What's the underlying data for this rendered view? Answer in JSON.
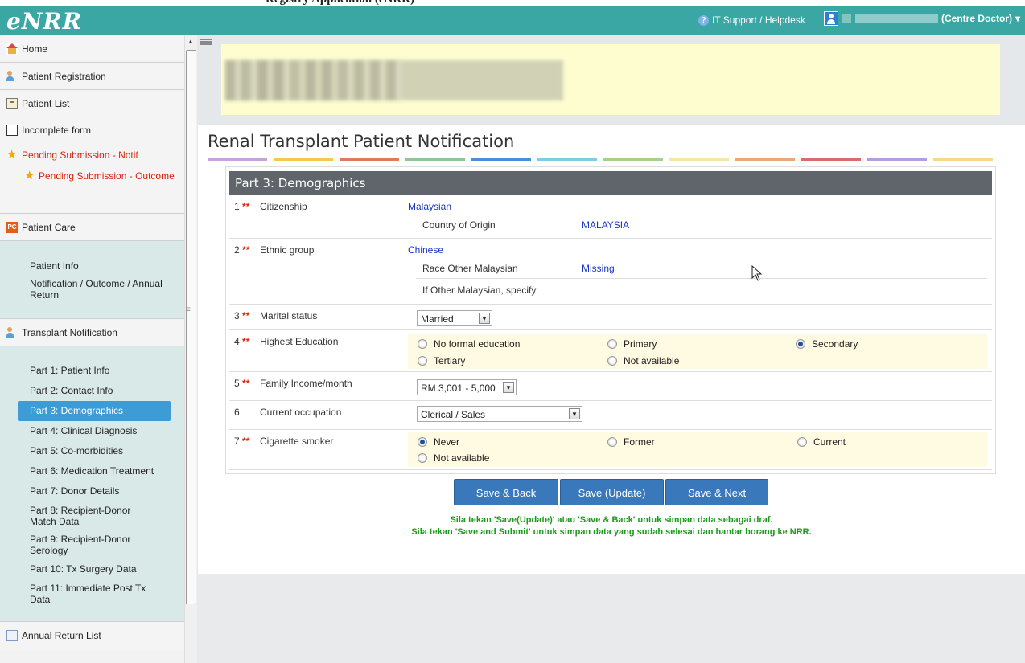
{
  "app": {
    "logo": "eNRR",
    "top_cut_text": "Registry Application (eNRR)",
    "helpdesk": "IT Support / Helpdesk",
    "user_role": "(Centre Doctor)"
  },
  "sidebar": {
    "items": [
      {
        "label": "Home",
        "icon": "home-icon"
      },
      {
        "label": "Patient Registration",
        "icon": "users-icon"
      },
      {
        "label": "Patient List",
        "icon": "list-icon"
      },
      {
        "label": "Incomplete form",
        "icon": "form-icon"
      },
      {
        "label": "Pending Submission - Notif",
        "icon": "star-icon"
      },
      {
        "label": "Pending Submission - Outcome",
        "icon": "star-icon"
      },
      {
        "label": "Patient Care",
        "icon": "pc-icon"
      },
      {
        "label": "Transplant Notification",
        "icon": "users-icon"
      },
      {
        "label": "Annual Return List",
        "icon": "doc-icon"
      }
    ],
    "pc_icon_text": "PC",
    "patient_care_links": [
      "Patient Info",
      "Notification / Outcome / Annual Return"
    ],
    "transplant_links": [
      "Part 1: Patient Info",
      "Part 2: Contact Info",
      "Part 3: Demographics",
      "Part 4: Clinical Diagnosis",
      "Part 5: Co-morbidities",
      "Part 6: Medication Treatment",
      "Part 7: Donor Details",
      "Part 8: Recipient-Donor Match Data",
      "Part 9: Recipient-Donor Serology",
      "Part 10: Tx Surgery Data",
      "Part 11: Immediate Post Tx Data"
    ]
  },
  "page": {
    "title": "Renal Transplant Patient Notification",
    "part_header": "Part 3: Demographics"
  },
  "form": {
    "q1": {
      "num": "1",
      "label": "Citizenship",
      "value": "Malaysian",
      "sub_label": "Country of Origin",
      "sub_value": "MALAYSIA"
    },
    "q2": {
      "num": "2",
      "label": "Ethnic group",
      "value": "Chinese",
      "sub_label": "Race Other Malaysian",
      "sub_value": "Missing",
      "sub_label2": "If Other Malaysian, specify"
    },
    "q3": {
      "num": "3",
      "label": "Marital status",
      "selected": "Married"
    },
    "q4": {
      "num": "4",
      "label": "Highest Education",
      "options": [
        "No formal education",
        "Primary",
        "Secondary",
        "Tertiary",
        "Not available"
      ],
      "selected": "Secondary"
    },
    "q5": {
      "num": "5",
      "label": "Family Income/month",
      "selected": "RM 3,001 - 5,000"
    },
    "q6": {
      "num": "6",
      "label": "Current occupation",
      "selected": "Clerical / Sales"
    },
    "q7": {
      "num": "7",
      "label": "Cigarette smoker",
      "options": [
        "Never",
        "Former",
        "Current",
        "Not available"
      ],
      "selected": "Never"
    },
    "required_mark": "**"
  },
  "buttons": {
    "save_back": "Save & Back",
    "save_update": "Save (Update)",
    "save_next": "Save & Next"
  },
  "notes": {
    "line1": "Sila tekan 'Save(Update)' atau 'Save & Back' untuk simpan data sebagai draf.",
    "line2": "Sila tekan 'Save and Submit' untuk simpan data yang sudah selesai dan hantar borang ke NRR."
  },
  "colors": {
    "navbar": "#3aa7a4",
    "active_link": "#3d9bd5",
    "button": "#3978ba",
    "required": "#d9230f",
    "value_text": "#1a35c6",
    "note_text": "#1c9a1c"
  }
}
